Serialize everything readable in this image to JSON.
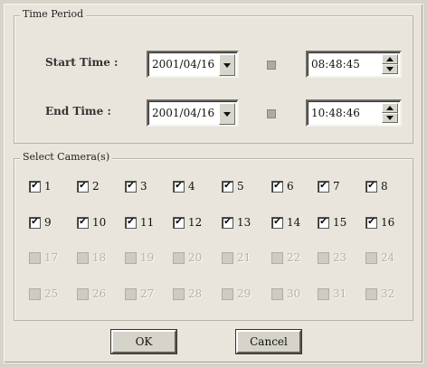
{
  "time_period": {
    "title": "Time Period",
    "start_label": "Start Time :",
    "end_label": "End Time :",
    "start_date": "2001/04/16",
    "start_time": "08:48:45",
    "end_date": "2001/04/16",
    "end_time": "10:48:46"
  },
  "cameras": {
    "title": "Select Camera(s)",
    "items": [
      {
        "n": "1",
        "checked": true,
        "enabled": true
      },
      {
        "n": "2",
        "checked": true,
        "enabled": true
      },
      {
        "n": "3",
        "checked": true,
        "enabled": true
      },
      {
        "n": "4",
        "checked": true,
        "enabled": true
      },
      {
        "n": "5",
        "checked": true,
        "enabled": true
      },
      {
        "n": "6",
        "checked": true,
        "enabled": true
      },
      {
        "n": "7",
        "checked": true,
        "enabled": true
      },
      {
        "n": "8",
        "checked": true,
        "enabled": true
      },
      {
        "n": "9",
        "checked": true,
        "enabled": true
      },
      {
        "n": "10",
        "checked": true,
        "enabled": true
      },
      {
        "n": "11",
        "checked": true,
        "enabled": true
      },
      {
        "n": "12",
        "checked": true,
        "enabled": true
      },
      {
        "n": "13",
        "checked": true,
        "enabled": true
      },
      {
        "n": "14",
        "checked": true,
        "enabled": true
      },
      {
        "n": "15",
        "checked": true,
        "enabled": true
      },
      {
        "n": "16",
        "checked": true,
        "enabled": true
      },
      {
        "n": "17",
        "checked": false,
        "enabled": false
      },
      {
        "n": "18",
        "checked": false,
        "enabled": false
      },
      {
        "n": "19",
        "checked": false,
        "enabled": false
      },
      {
        "n": "20",
        "checked": false,
        "enabled": false
      },
      {
        "n": "21",
        "checked": false,
        "enabled": false
      },
      {
        "n": "22",
        "checked": false,
        "enabled": false
      },
      {
        "n": "23",
        "checked": false,
        "enabled": false
      },
      {
        "n": "24",
        "checked": false,
        "enabled": false
      },
      {
        "n": "25",
        "checked": false,
        "enabled": false
      },
      {
        "n": "26",
        "checked": false,
        "enabled": false
      },
      {
        "n": "27",
        "checked": false,
        "enabled": false
      },
      {
        "n": "28",
        "checked": false,
        "enabled": false
      },
      {
        "n": "29",
        "checked": false,
        "enabled": false
      },
      {
        "n": "30",
        "checked": false,
        "enabled": false
      },
      {
        "n": "31",
        "checked": false,
        "enabled": false
      },
      {
        "n": "32",
        "checked": false,
        "enabled": false
      }
    ]
  },
  "buttons": {
    "ok": "OK",
    "cancel": "Cancel"
  }
}
